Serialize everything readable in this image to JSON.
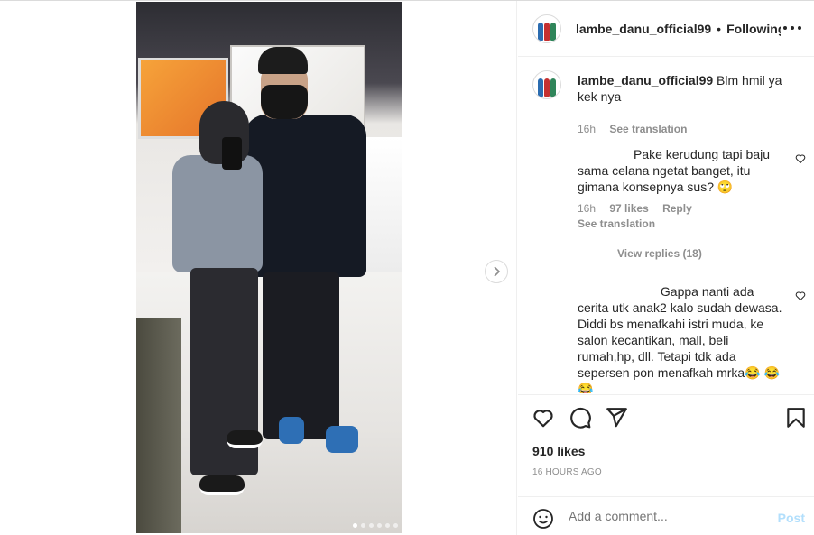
{
  "post": {
    "username": "lambe_danu_official99",
    "separator": "•",
    "follow_status": "Following",
    "more_icon": "more-horizontal-icon",
    "carousel": {
      "slide_count": 7,
      "active_index": 0
    }
  },
  "caption": {
    "username": "lambe_danu_official99",
    "text": " Blm hmil ya kek nya",
    "time": "16h",
    "see_translation": "See translation"
  },
  "comments": [
    {
      "text": "Pake kerudung tapi baju sama celana ngetat banget, itu gimana konsepnya sus? 🙄",
      "time": "16h",
      "likes": "97 likes",
      "reply": "Reply",
      "see_translation": "See translation",
      "view_replies": "View replies (18)"
    },
    {
      "text": " Gappa nanti ada cerita utk anak2 kalo sudah dewasa. Diddi bs menafkahi istri muda, ke salon kecantikan, mall, beli rumah,hp, dll. Tetapi tdk ada sepersen pon menafkah mrka😂 😂 😂"
    }
  ],
  "footer": {
    "likes": "910 likes",
    "time_ago": "16 HOURS AGO",
    "comment_placeholder": "Add a comment...",
    "post_label": "Post"
  },
  "colors": {
    "text": "#262626",
    "secondary": "#8e8e8e",
    "post_disabled": "#b2dffc",
    "border": "#efefef"
  }
}
